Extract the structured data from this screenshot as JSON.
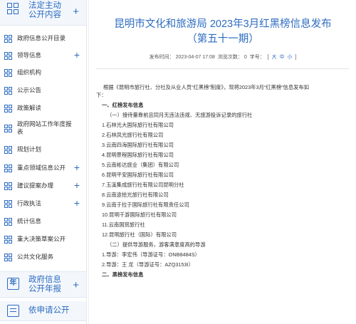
{
  "sidebar": {
    "section1": {
      "label_line1": "法定主动",
      "label_line2": "公开内容"
    },
    "items": [
      {
        "label": "政府信息公开目录",
        "plus": ""
      },
      {
        "label": "领导信息",
        "plus": "+"
      },
      {
        "label": "组织机构",
        "plus": ""
      },
      {
        "label": "公示公告",
        "plus": ""
      },
      {
        "label": "政策解读",
        "plus": ""
      },
      {
        "label": "政府网站工作年度报表",
        "plus": ""
      },
      {
        "label": "规划计划",
        "plus": ""
      },
      {
        "label": "重点领域信息公开",
        "plus": "+"
      },
      {
        "label": "建议提案办理",
        "plus": "+"
      },
      {
        "label": "行政执法",
        "plus": "+"
      },
      {
        "label": "统计信息",
        "plus": ""
      },
      {
        "label": "重大决策草案公开",
        "plus": ""
      },
      {
        "label": "公共文化服务",
        "plus": ""
      }
    ],
    "section2": {
      "icon_text": "年",
      "label_line1": "政府信息",
      "label_line2": "公开年报"
    },
    "section3": {
      "label": "依申请公开"
    },
    "plus_symbol": "+"
  },
  "article": {
    "title_line1": "昆明市文化和旅游局 2023年3月红黑榜信息发布",
    "title_line2": "（第五十一期）",
    "meta": {
      "published_label": "发布时间：",
      "published_value": "2023-04-07 17:08",
      "views_label": "浏览次数：",
      "views_value": "0",
      "font_label": "字号：",
      "bracket_open": "[",
      "size_large": "大",
      "size_medium": "中",
      "size_small": "小",
      "bracket_close": "]"
    },
    "paragraphs": [
      "根据《昆明市旅行社、分社及从业人员“红黑榜”制度》，现将2023年3月“红黑榜”信息发布如",
      "下：",
      "一、红榜发布信息",
      "（一）接待量靠前且同月无违法违规、无旅游投诉记录的旅行社",
      "1.石林光大国际旅行社有限公司",
      "2.石林凤光旅行社有限公司",
      "3.云南四海国际旅行社有限公司",
      "4.昆明景程国际旅行社有限公司",
      "5.云南彬达旅业（集团）有限公司",
      "6.昆明平安国际旅行社有限公司",
      "7.玉溪集成旅行社有限公司昆明分社",
      "8.云南途拾光旅行社有限公司",
      "9.云南于拉于国际旅行社有限责任公司",
      "10.昆明千游国际旅行社有限公司",
      "11.云南国贸旅行社",
      "12.昆明旅行社（国际）有限公司",
      "（二）提供导游服务，游客满意度高的导游",
      "1.导游：李宏伟（导游证号：ONB8484S）",
      "2.导游：王  龙（导游证号：AZQ3153I）",
      "二、黑榜发布信息"
    ]
  },
  "colors": {
    "accent": "#2d6cc0",
    "section_bg": "#f3f7fc"
  }
}
